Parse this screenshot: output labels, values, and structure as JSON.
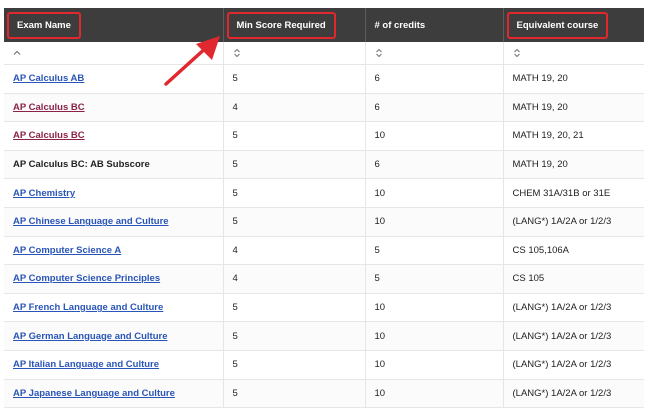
{
  "table": {
    "columns": [
      "Exam Name",
      "Min Score Required",
      "# of credits",
      "Equivalent course"
    ],
    "highlighted_columns": [
      0,
      1,
      3
    ],
    "highlight_color": "#e0282e",
    "header_bg": "#3d3d3d",
    "link_color": "#2955b8",
    "visited_link_color": "#8a2248",
    "sort_icons": [
      "sort-ascending-icon",
      "sort-both-icon",
      "sort-both-icon",
      "sort-both-icon"
    ],
    "rows": [
      {
        "exam": "AP Calculus AB",
        "min_score": "5",
        "credits": "6",
        "course": "MATH 19, 20",
        "style": "link"
      },
      {
        "exam": "AP Calculus BC",
        "min_score": "4",
        "credits": "6",
        "course": "MATH 19, 20",
        "style": "visited"
      },
      {
        "exam": "AP Calculus BC",
        "min_score": "5",
        "credits": "10",
        "course": "MATH 19, 20, 21",
        "style": "visited"
      },
      {
        "exam": "AP Calculus BC: AB Subscore",
        "min_score": "5",
        "credits": "6",
        "course": "MATH 19, 20",
        "style": "plain"
      },
      {
        "exam": "AP Chemistry",
        "min_score": "5",
        "credits": "10",
        "course": "CHEM 31A/31B or 31E",
        "style": "link"
      },
      {
        "exam": "AP Chinese Language and Culture",
        "min_score": "5",
        "credits": "10",
        "course": "(LANG*) 1A/2A or 1/2/3",
        "style": "link"
      },
      {
        "exam": "AP Computer Science A",
        "min_score": "4",
        "credits": "5",
        "course": "CS 105,106A",
        "style": "link"
      },
      {
        "exam": "AP Computer Science Principles",
        "min_score": "4",
        "credits": "5",
        "course": "CS 105",
        "style": "link"
      },
      {
        "exam": "AP French Language and Culture",
        "min_score": "5",
        "credits": "10",
        "course": "(LANG*) 1A/2A or 1/2/3",
        "style": "link"
      },
      {
        "exam": "AP German Language and Culture",
        "min_score": "5",
        "credits": "10",
        "course": "(LANG*) 1A/2A or 1/2/3",
        "style": "link"
      },
      {
        "exam": "AP Italian Language and Culture",
        "min_score": "5",
        "credits": "10",
        "course": "(LANG*) 1A/2A or 1/2/3",
        "style": "link"
      },
      {
        "exam": "AP Japanese Language and Culture",
        "min_score": "5",
        "credits": "10",
        "course": "(LANG*) 1A/2A or 1/2/3",
        "style": "link"
      }
    ]
  }
}
